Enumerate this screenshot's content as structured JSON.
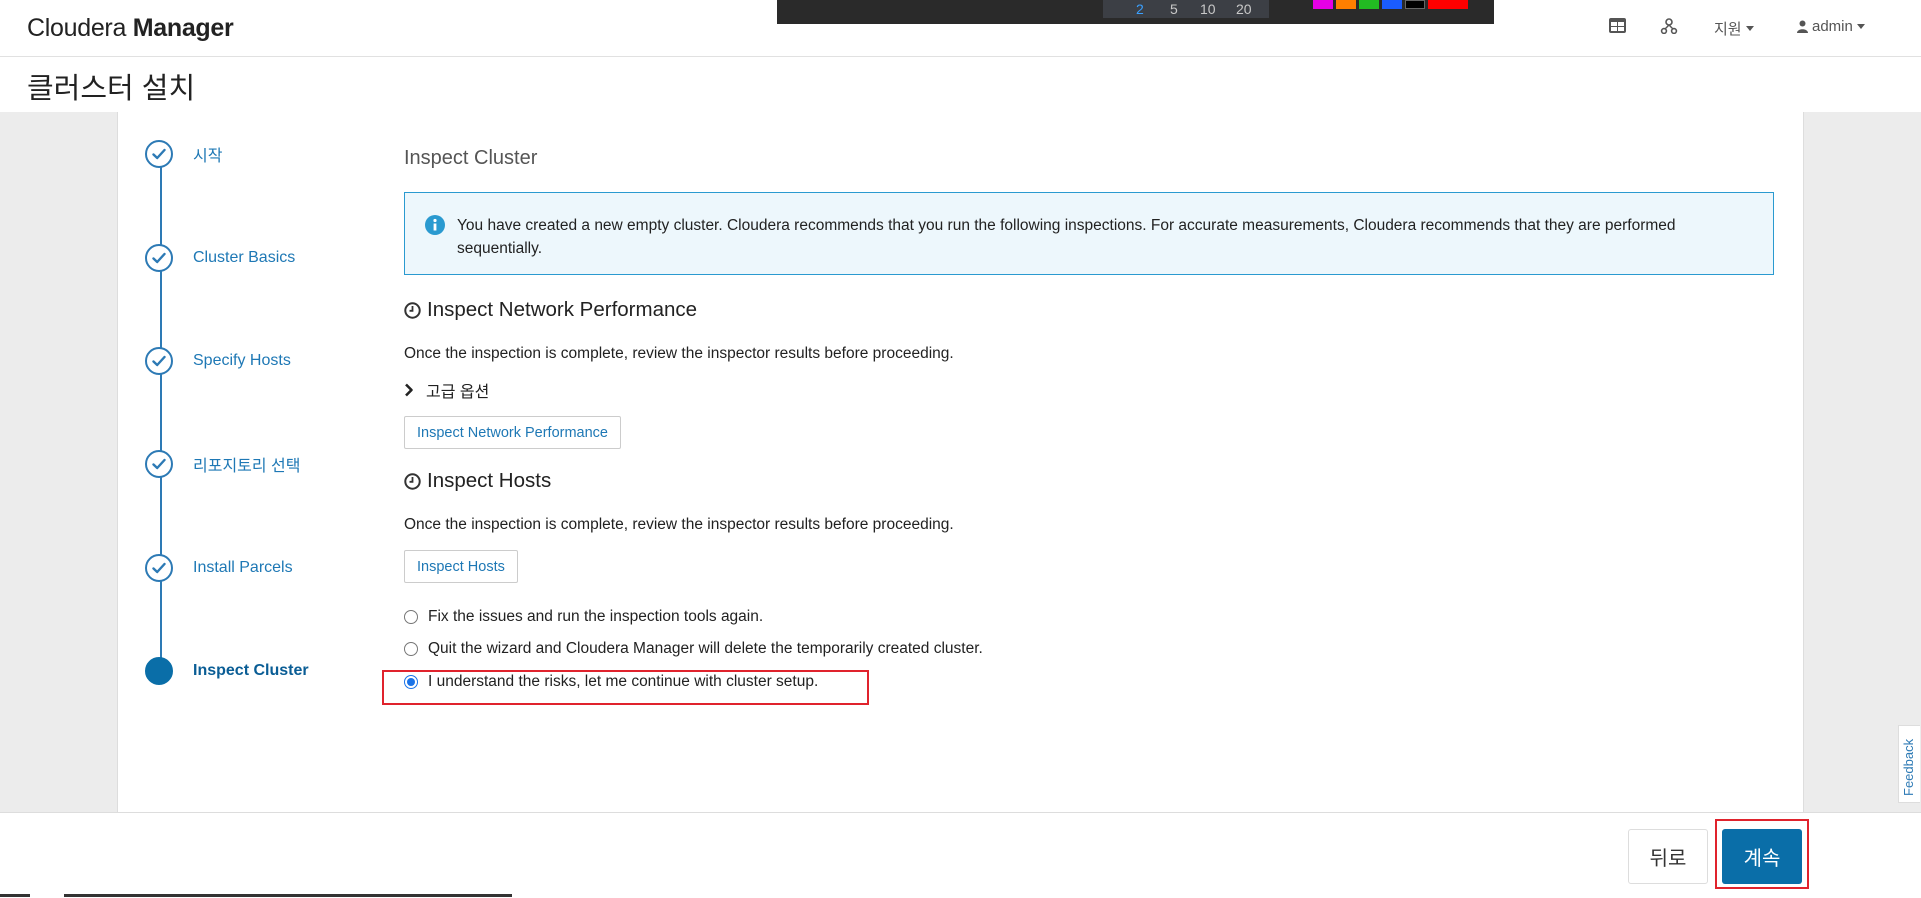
{
  "header": {
    "brand_part1": "Cloudera",
    "brand_part2": "Manager",
    "support_label": "지원",
    "user_label": "admin"
  },
  "overlay_toolbar": {
    "numbers": [
      "2",
      "5",
      "10",
      "20"
    ],
    "selected": "2",
    "swatches": [
      "#e600e6",
      "#ff7f00",
      "#22bb22",
      "#1a5cff",
      "#000000",
      "#ff0000"
    ]
  },
  "page": {
    "title": "클러스터 설치"
  },
  "wizard": {
    "steps": [
      {
        "label": "시작",
        "status": "done"
      },
      {
        "label": "Cluster Basics",
        "status": "done"
      },
      {
        "label": "Specify Hosts",
        "status": "done"
      },
      {
        "label": "리포지토리 선택",
        "status": "done"
      },
      {
        "label": "Install Parcels",
        "status": "done"
      },
      {
        "label": "Inspect Cluster",
        "status": "current"
      }
    ]
  },
  "main": {
    "title": "Inspect Cluster",
    "info_text": "You have created a new empty cluster. Cloudera recommends that you run the following inspections. For accurate measurements, Cloudera recommends that they are performed sequentially.",
    "network": {
      "heading": "Inspect Network Performance",
      "desc": "Once the inspection is complete, review the inspector results before proceeding.",
      "advanced_label": "고급 옵션",
      "button_label": "Inspect Network Performance"
    },
    "hosts": {
      "heading": "Inspect Hosts",
      "desc": "Once the inspection is complete, review the inspector results before proceeding.",
      "button_label": "Inspect Hosts"
    },
    "options": [
      {
        "label": "Fix the issues and run the inspection tools again.",
        "checked": false
      },
      {
        "label": "Quit the wizard and Cloudera Manager will delete the temporarily created cluster.",
        "checked": false
      },
      {
        "label": "I understand the risks, let me continue with cluster setup.",
        "checked": true
      }
    ]
  },
  "footer": {
    "back_label": "뒤로",
    "continue_label": "계속"
  },
  "feedback_label": "Feedback",
  "colors": {
    "accent": "#0a6ea8",
    "link": "#1e78b5",
    "highlight_box": "#e0232d"
  }
}
